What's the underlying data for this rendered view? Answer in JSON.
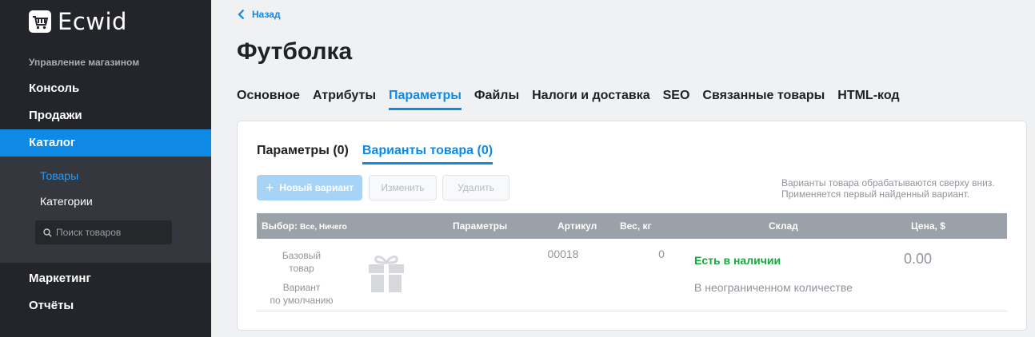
{
  "sidebar": {
    "logo_text": "Ecwid",
    "section_title": "Управление магазином",
    "items": [
      {
        "label": "Консоль"
      },
      {
        "label": "Продажи"
      },
      {
        "label": "Каталог"
      },
      {
        "label": "Маркетинг"
      },
      {
        "label": "Отчёты"
      }
    ],
    "sub_items": [
      {
        "label": "Товары"
      },
      {
        "label": "Категории"
      }
    ],
    "search_placeholder": "Поиск товаров"
  },
  "header": {
    "back_label": "Назад",
    "title": "Футболка"
  },
  "tabs": [
    {
      "label": "Основное"
    },
    {
      "label": "Атрибуты"
    },
    {
      "label": "Параметры"
    },
    {
      "label": "Файлы"
    },
    {
      "label": "Налоги и доставка"
    },
    {
      "label": "SEO"
    },
    {
      "label": "Связанные товары"
    },
    {
      "label": "HTML-код"
    }
  ],
  "card": {
    "subtabs": [
      {
        "label": "Параметры (0)"
      },
      {
        "label": "Варианты товара (0)"
      }
    ],
    "buttons": {
      "new_variant": "Новый вариант",
      "edit": "Изменить",
      "delete": "Удалить"
    },
    "hint": "Варианты товара обрабатываются сверху вниз. Применяется первый найденный вариант.",
    "table": {
      "select_label": "Выбор:",
      "select_options": "Все, Ничего",
      "columns": [
        "Параметры",
        "Артикул",
        "Вес, кг",
        "Склад",
        "Цена, $"
      ],
      "row": {
        "base_label_1": "Базовый",
        "base_label_2": "товар",
        "variant_label_1": "Вариант",
        "variant_label_2": "по умолчанию",
        "sku": "00018",
        "weight": "0",
        "stock_status": "Есть в наличии",
        "stock_quantity": "В неограниченном количестве",
        "price": "0.00"
      }
    }
  },
  "colors": {
    "accent": "#0e8ae6",
    "sidebar_bg": "#23252a",
    "in_stock": "#18a83e"
  }
}
